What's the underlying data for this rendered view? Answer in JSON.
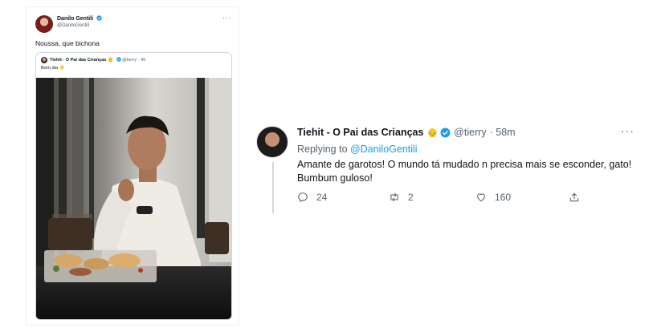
{
  "left_tweet": {
    "author_name": "Danilo Gentili",
    "author_handle": "@DaniloGentili",
    "more": "···",
    "text": "Noussa, que bichona",
    "quoted": {
      "author_name": "Tiehit - O Pai das Crianças",
      "author_emoji": "👴",
      "author_handle": "@tierry",
      "time": "· 4h",
      "text": "Bom dia ☀️"
    }
  },
  "right_tweet": {
    "author_name": "Tiehit - O Pai das Crianças",
    "author_emoji": "👴",
    "author_handle": "@tierry",
    "time": "· 58m",
    "more": "···",
    "replying_prefix": "Replying to",
    "replying_to": "@DaniloGentili",
    "text": "Amante de garotos! O mundo tá mudado n precisa mais se esconder, gato! Bumbum guloso!",
    "actions": {
      "reply_count": "24",
      "retweet_count": "2",
      "like_count": "160"
    }
  },
  "colors": {
    "accent": "#1d9bf0",
    "secondary_text": "#536471",
    "border": "#cfd9de"
  },
  "icons": [
    "verified-badge-icon",
    "more-icon",
    "reply-icon",
    "retweet-icon",
    "like-icon",
    "share-icon"
  ]
}
